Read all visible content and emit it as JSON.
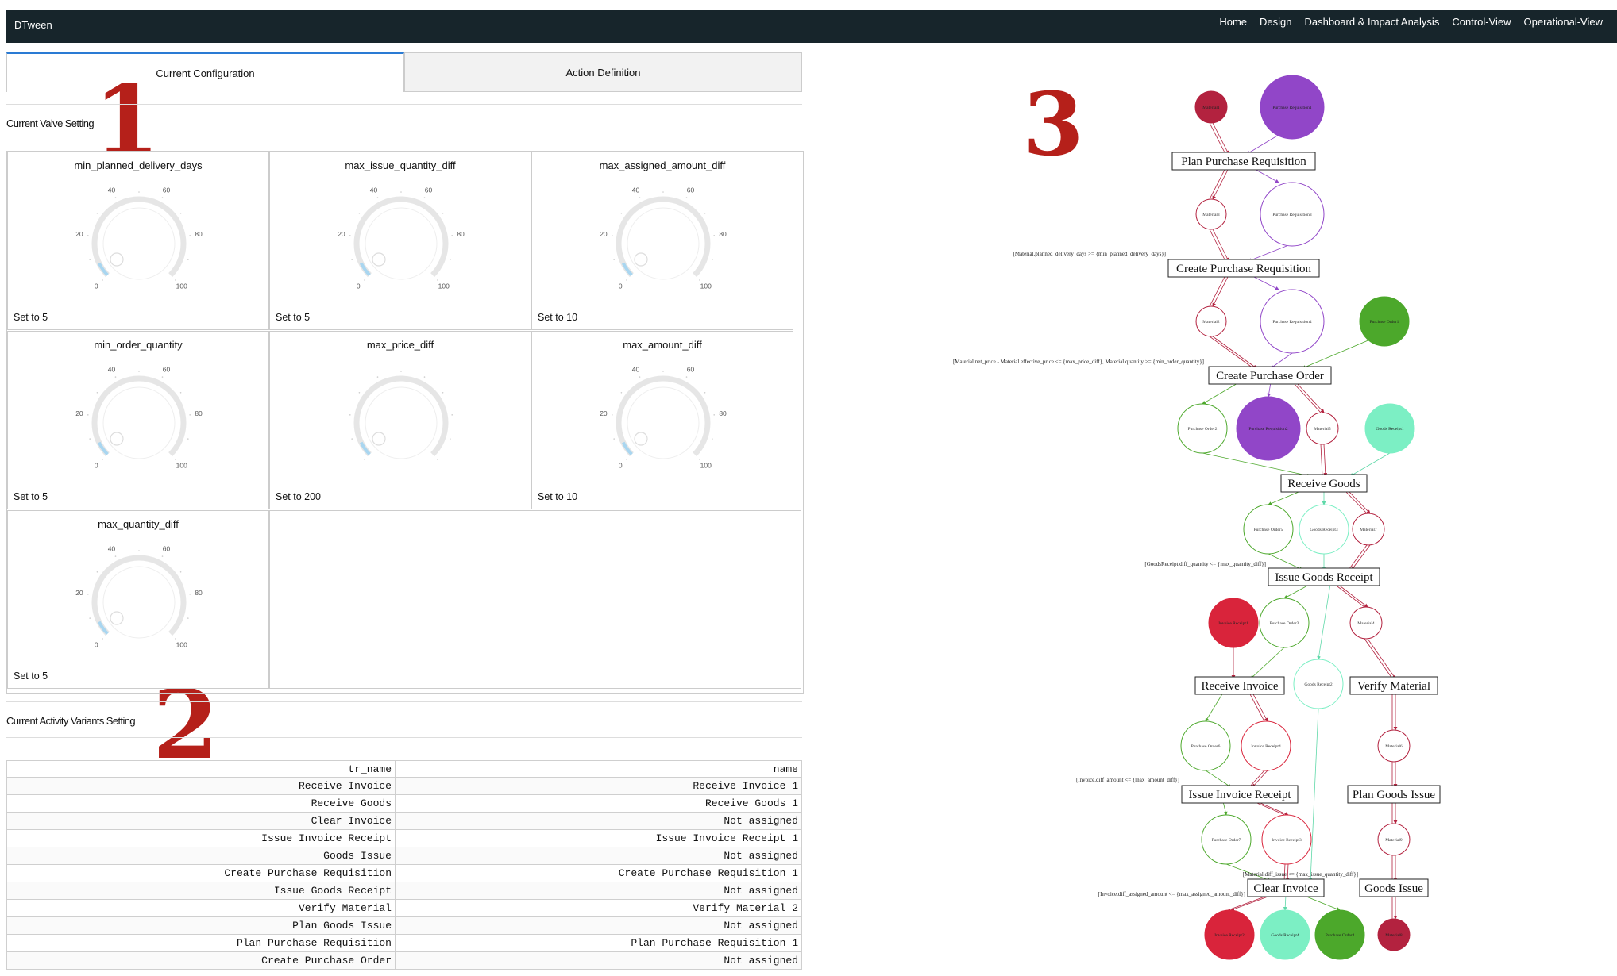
{
  "app": {
    "brand": "DTween"
  },
  "nav": {
    "links": [
      "Home",
      "Design",
      "Dashboard & Impact Analysis",
      "Control-View",
      "Operational-View"
    ]
  },
  "tabs": [
    {
      "label": "Current Configuration",
      "active": true
    },
    {
      "label": "Action Definition",
      "active": false
    }
  ],
  "annotations": {
    "one": "1",
    "two": "2",
    "three": "3"
  },
  "valve_section": {
    "title": "Current Valve Setting"
  },
  "gauges": [
    {
      "name": "min_planned_delivery_days",
      "set": "Set to 5",
      "value": 5,
      "ticks": [
        "0",
        "20",
        "40",
        "60",
        "80",
        "100"
      ]
    },
    {
      "name": "max_issue_quantity_diff",
      "set": "Set to 5",
      "value": 5,
      "ticks": [
        "0",
        "20",
        "40",
        "60",
        "80",
        "100"
      ]
    },
    {
      "name": "max_assigned_amount_diff",
      "set": "Set to 10",
      "value": 10,
      "ticks": [
        "0",
        "20",
        "40",
        "60",
        "80",
        "100"
      ]
    },
    {
      "name": "min_order_quantity",
      "set": "Set to 5",
      "value": 5,
      "ticks": [
        "0",
        "20",
        "40",
        "60",
        "80",
        "100"
      ]
    },
    {
      "name": "max_price_diff",
      "set": "Set to 200",
      "value": 200,
      "ticks": []
    },
    {
      "name": "max_amount_diff",
      "set": "Set to 10",
      "value": 10,
      "ticks": [
        "0",
        "20",
        "40",
        "60",
        "80",
        "100"
      ]
    },
    {
      "name": "max_quantity_diff",
      "set": "Set to 5",
      "value": 5,
      "ticks": [
        "0",
        "20",
        "40",
        "60",
        "80",
        "100"
      ]
    }
  ],
  "variants_section": {
    "title": "Current Activity Variants Setting"
  },
  "variants_table": {
    "headers": [
      "tr_name",
      "name"
    ],
    "rows": [
      [
        "Receive Invoice",
        "Receive Invoice 1"
      ],
      [
        "Receive Goods",
        "Receive Goods 1"
      ],
      [
        "Clear Invoice",
        "Not assigned"
      ],
      [
        "Issue Invoice Receipt",
        "Issue Invoice Receipt 1"
      ],
      [
        "Goods Issue",
        "Not assigned"
      ],
      [
        "Create Purchase Requisition",
        "Create Purchase Requisition 1"
      ],
      [
        "Issue Goods Receipt",
        "Not assigned"
      ],
      [
        "Verify Material",
        "Verify Material 2"
      ],
      [
        "Plan Goods Issue",
        "Not assigned"
      ],
      [
        "Plan Purchase Requisition",
        "Plan Purchase Requisition 1"
      ],
      [
        "Create Purchase Order",
        "Not assigned"
      ]
    ]
  },
  "graph": {
    "colors": {
      "material": "#b3223f",
      "purchase_requisition": "#9146c8",
      "purchase_order": "#4ca82b",
      "goods_receipt": "#7cefc4",
      "invoice_receipt": "#d9243b",
      "edge_red": "#b3223f"
    },
    "transitions": [
      "Plan Purchase Requisition",
      "Create Purchase Requisition",
      "Create Purchase Order",
      "Receive Goods",
      "Issue Goods Receipt",
      "Receive Invoice",
      "Verify Material",
      "Issue Invoice Receipt",
      "Plan Goods Issue",
      "Clear Invoice",
      "Goods Issue"
    ],
    "guards": [
      "[Material.planned_delivery_days >= {min_planned_delivery_days}]",
      "[Material.net_price - Material.effective_price <= {max_price_diff}, Material.quantity >= {min_order_quantity}]",
      "[GoodsReceipt.diff_quantity <= {max_quantity_diff}]",
      "[Invoice.diff_amount <= {max_amount_diff}]",
      "[Material.diff_issue <= {max_issue_quantity_diff}]",
      "[Invoice.diff_assigned_amount <= {max_assigned_amount_diff}]"
    ],
    "places": [
      "Material1",
      "Purchase Requisition1",
      "Material3",
      "Purchase Requisition3",
      "Material2",
      "Purchase Requisition4",
      "Purchase Order1",
      "Purchase Order2",
      "Purchase Requisition2",
      "Material5",
      "Goods Receipt1",
      "Purchase Order5",
      "Goods Receipt3",
      "Material7",
      "Invoice Receipt1",
      "Purchase Order3",
      "Material4",
      "Goods Receipt2",
      "Purchase Order6",
      "Invoice Receipt4",
      "Material6",
      "Purchase Order7",
      "Invoice Receipt3",
      "Material9",
      "Invoice Receipt2",
      "Goods Receipt4",
      "Purchase Order4",
      "Material8"
    ]
  }
}
